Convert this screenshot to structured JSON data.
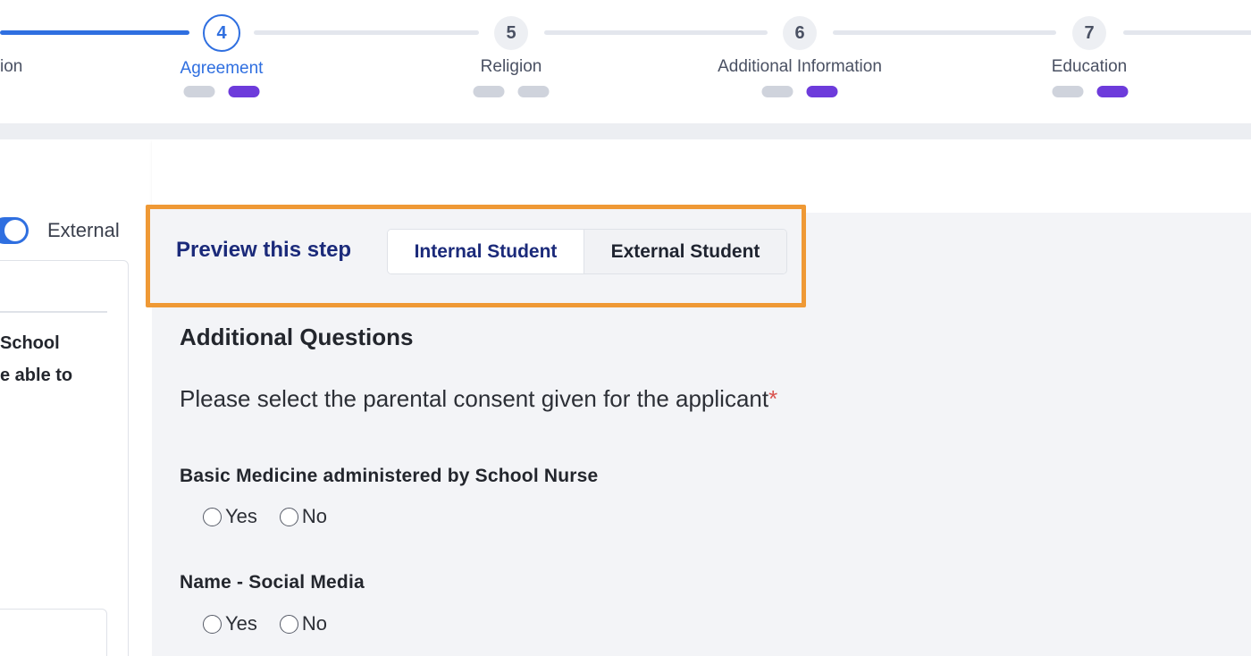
{
  "stepper": {
    "steps": [
      {
        "label": "ion"
      },
      {
        "number": "4",
        "label": "Agreement"
      },
      {
        "number": "5",
        "label": "Religion"
      },
      {
        "number": "6",
        "label": "Additional Information"
      },
      {
        "number": "7",
        "label": "Education"
      }
    ],
    "active_step": "4",
    "colors": {
      "active": "#2f6fe0",
      "pill_purple": "#6d3bdb",
      "pill_grey": "#cfd3dc"
    }
  },
  "left_panel": {
    "toggle_label": "External",
    "text_lines": [
      "School",
      "e able to"
    ]
  },
  "preview": {
    "label": "Preview this step",
    "internal_button": "Internal Student",
    "external_button": "External Student",
    "highlight_color": "#ef9935"
  },
  "form": {
    "section_title": "Additional Questions",
    "instruction": "Please select the parental consent given for the applicant",
    "required_mark": "*",
    "questions": [
      {
        "label": "Basic Medicine administered by School Nurse",
        "options": [
          "Yes",
          "No"
        ]
      },
      {
        "label": "Name - Social Media",
        "options": [
          "Yes",
          "No"
        ]
      }
    ]
  }
}
